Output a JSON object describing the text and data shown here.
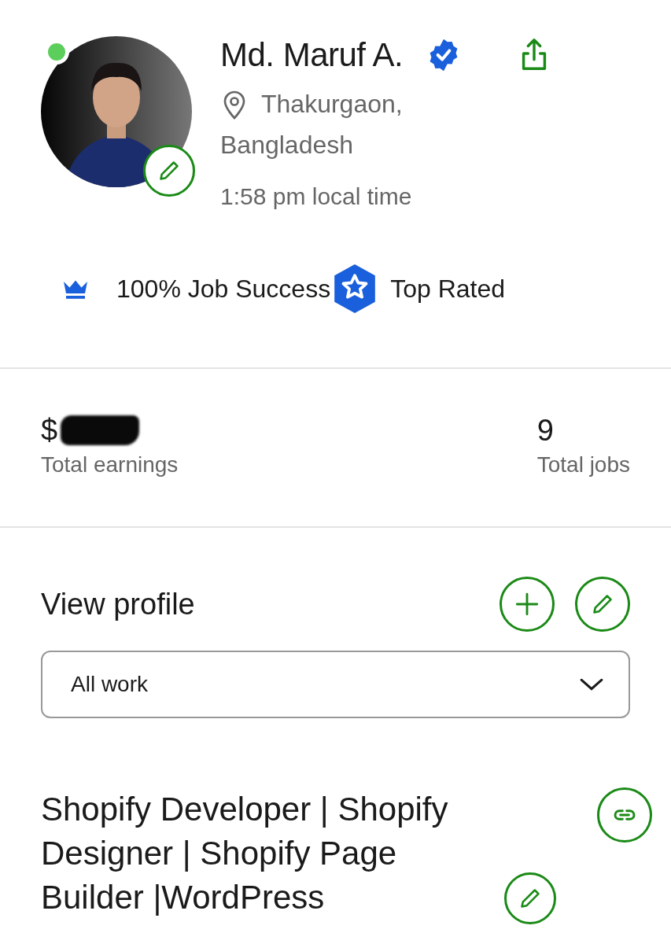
{
  "profile": {
    "online": true,
    "name": "Md. Maruf A.",
    "verified": true,
    "location": [
      "Thakurgaon,",
      "Bangladesh"
    ],
    "local_time": "1:58 pm local time"
  },
  "badges": [
    {
      "kind": "crown",
      "label": "100% Job Success"
    },
    {
      "kind": "hexstar",
      "label": "Top Rated"
    }
  ],
  "stats": [
    {
      "value": "$",
      "redacted": true,
      "label": "Total earnings"
    },
    {
      "value": "9",
      "redacted": false,
      "label": "Total jobs"
    }
  ],
  "section": {
    "title": "View profile"
  },
  "filter": {
    "value": "All work"
  },
  "headline": "Shopify Developer | Shopify Designer | Shopify Page Builder |WordPress"
}
